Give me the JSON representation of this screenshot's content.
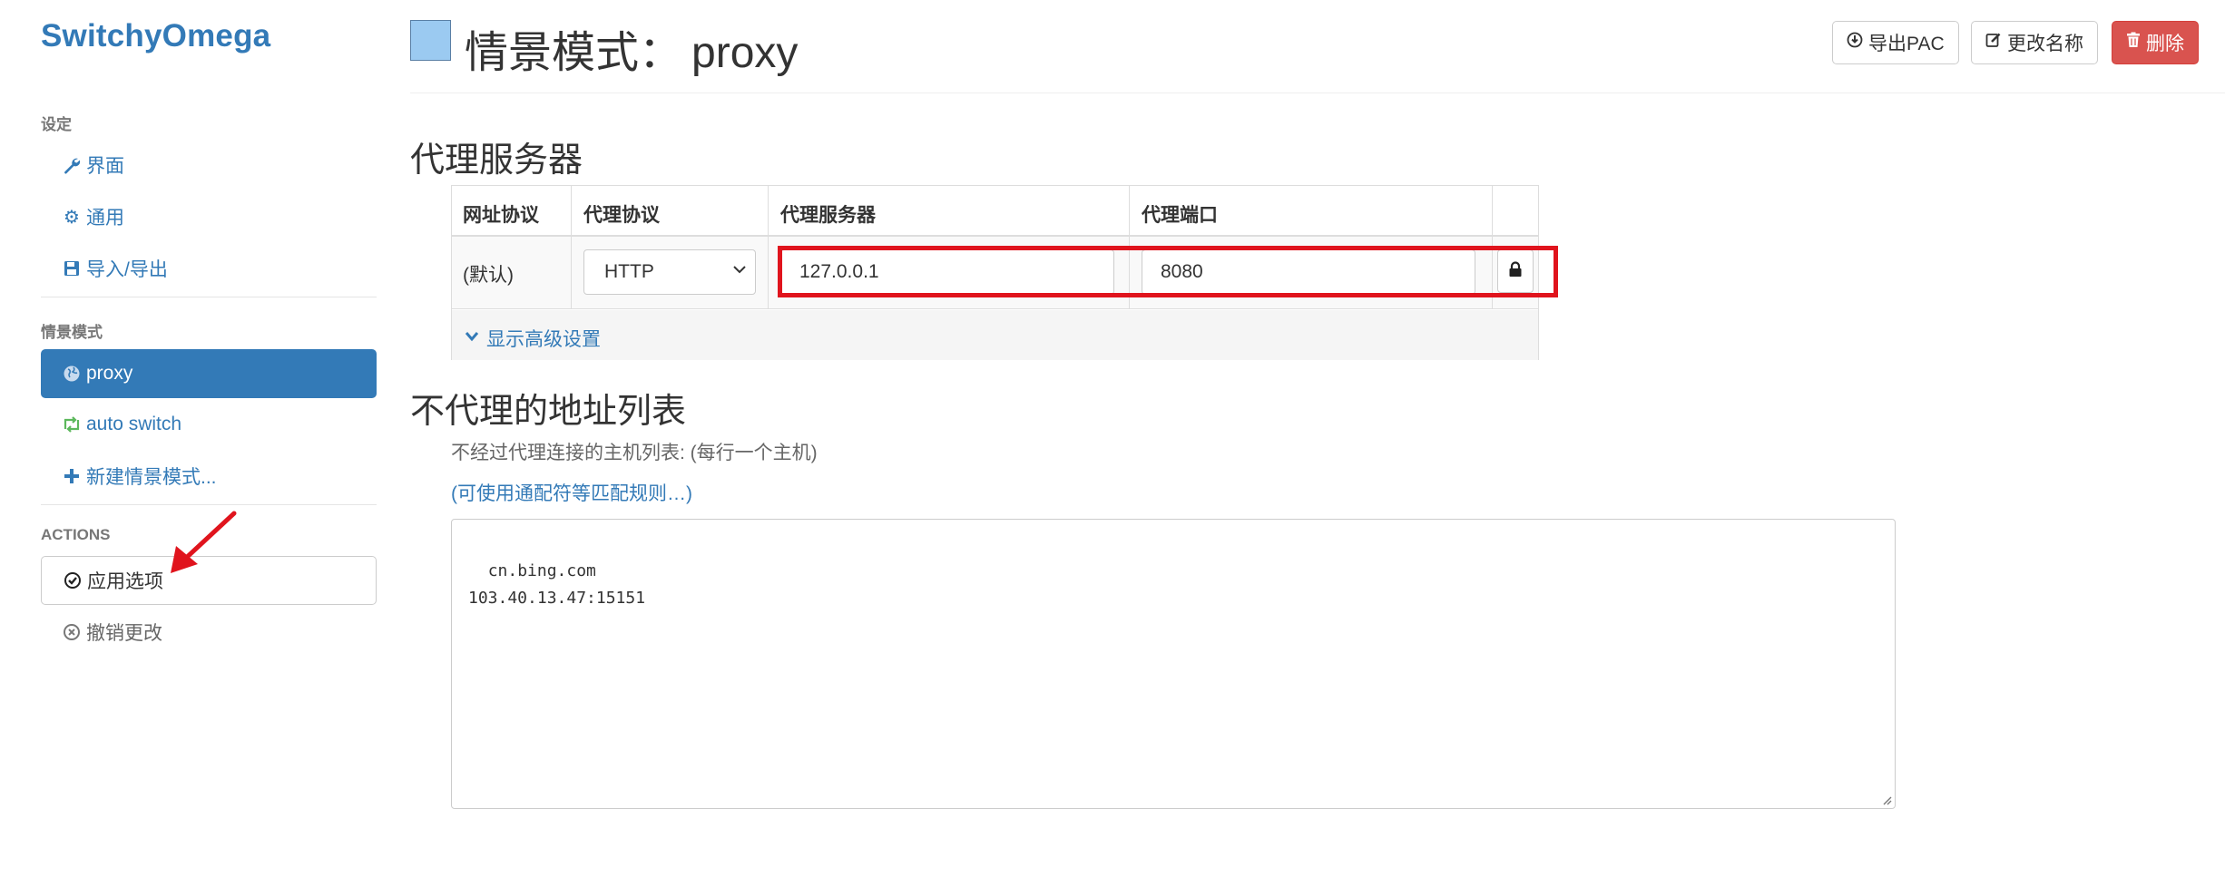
{
  "app": {
    "brand": "SwitchyOmega"
  },
  "sidebar": {
    "settings_header": "设定",
    "settings_items": [
      {
        "label": "界面",
        "icon": "wrench-icon"
      },
      {
        "label": "通用",
        "icon": "gear-icon"
      },
      {
        "label": "导入/导出",
        "icon": "floppy-icon"
      }
    ],
    "profiles_header": "情景模式",
    "profiles": [
      {
        "label": "proxy",
        "icon": "globe-icon",
        "active": true
      },
      {
        "label": "auto switch",
        "icon": "retweet-icon"
      },
      {
        "label": "新建情景模式...",
        "icon": "plus-icon"
      }
    ],
    "actions_header": "ACTIONS",
    "actions": [
      {
        "label": "应用选项",
        "icon": "check-circle-icon"
      },
      {
        "label": "撤销更改",
        "icon": "x-circle-icon"
      }
    ]
  },
  "header": {
    "title_prefix": "情景模式：",
    "profile_name": "proxy",
    "swatch_color": "#9bcaf1",
    "buttons": {
      "export": "导出PAC",
      "rename": "更改名称",
      "delete": "删除"
    }
  },
  "proxy_section": {
    "heading": "代理服务器",
    "columns": [
      "网址协议",
      "代理协议",
      "代理服务器",
      "代理端口"
    ],
    "row": {
      "scheme": "(默认)",
      "protocol": "HTTP",
      "server": "127.0.0.1",
      "port": "8080"
    },
    "advanced_link": "显示高级设置"
  },
  "bypass_section": {
    "heading": "不代理的地址列表",
    "help": "不经过代理连接的主机列表: (每行一个主机)",
    "wildcard_link": "(可使用通配符等匹配规则…)",
    "list": "cn.bing.com\n103.40.13.47:15151"
  },
  "colors": {
    "primary": "#337ab7",
    "danger": "#d9534f",
    "highlight": "#e0141d",
    "success": "#5cb85c"
  }
}
